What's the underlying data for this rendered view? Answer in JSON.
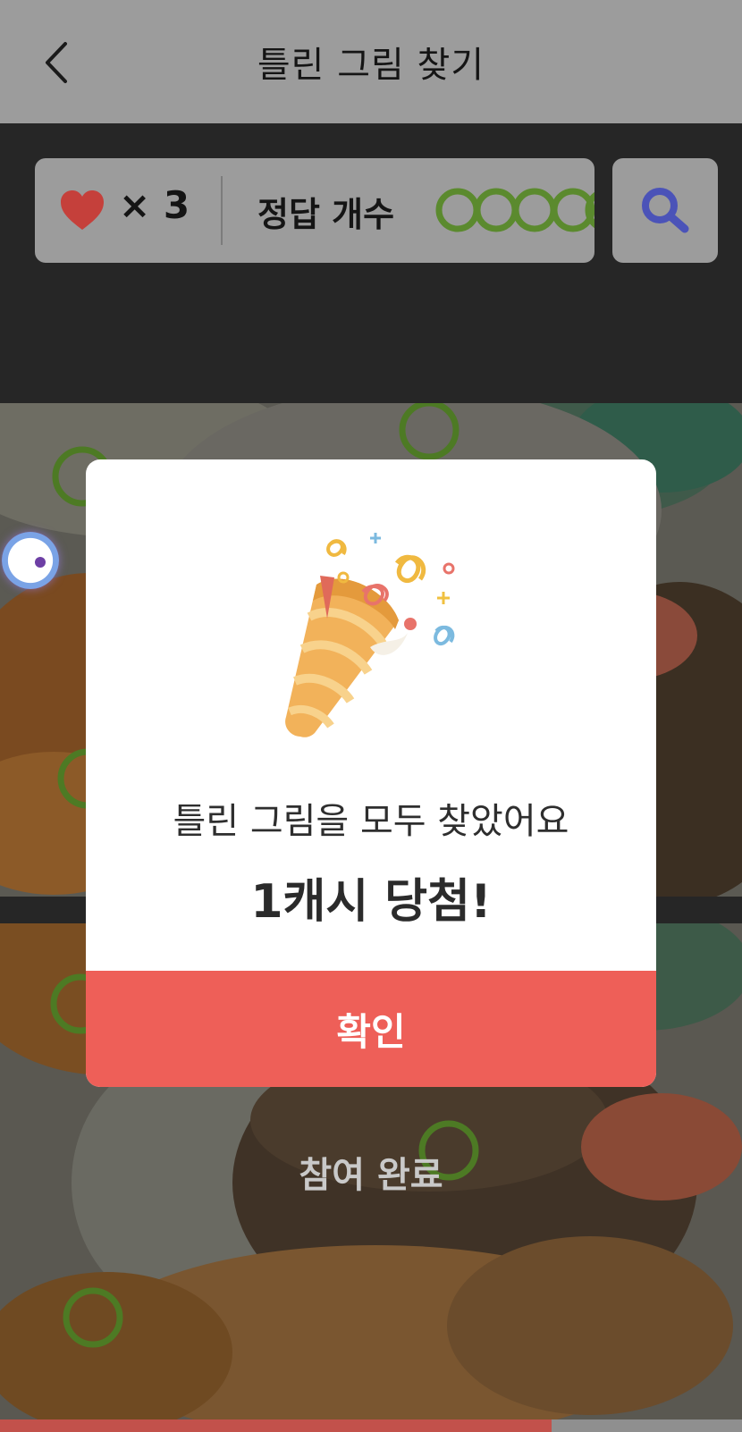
{
  "header": {
    "title": "틀린 그림 찾기",
    "back_icon": "chevron-left-icon"
  },
  "status": {
    "heart_icon": "heart-icon",
    "lives_text": "× 3",
    "answer_label": "정답 개수",
    "answers_found": 5,
    "search_icon": "magnifier-icon"
  },
  "background": {
    "done_text": "참여 완료"
  },
  "modal": {
    "icon": "party-popper-icon",
    "message": "틀린 그림을 모두 찾았어요",
    "prize": "1캐시 당첨!",
    "confirm_label": "확인"
  },
  "colors": {
    "accent": "#ee5f58",
    "ring": "#5b8a2e",
    "search_icon": "#4b53b8",
    "heart": "#c5403b"
  }
}
